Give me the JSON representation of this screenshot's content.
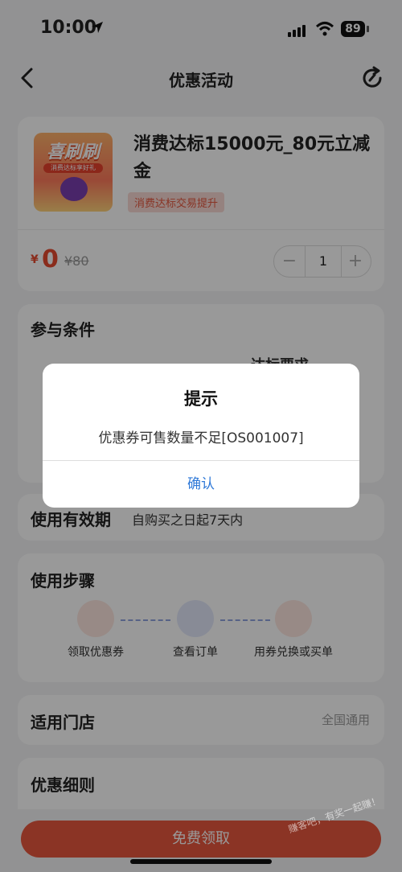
{
  "status_bar": {
    "time": "10:00",
    "battery": "89"
  },
  "nav": {
    "title": "优惠活动"
  },
  "product": {
    "thumb_title": "喜刷刷",
    "thumb_subtitle": "消费达标享好礼",
    "title": "消费达标15000元_80元立减金",
    "tag": "消费达标交易提升",
    "price_symbol": "¥",
    "price": "0",
    "original_price": "¥80",
    "quantity": "1"
  },
  "conditions": {
    "title": "参与条件",
    "col_header": "达标要求"
  },
  "validity": {
    "title": "使用有效期",
    "value": "自购买之日起7天内"
  },
  "steps": {
    "title": "使用步骤",
    "items": [
      {
        "label": "领取优惠券"
      },
      {
        "label": "查看订单"
      },
      {
        "label": "用券兑换或买单"
      }
    ]
  },
  "stores": {
    "title": "适用门店",
    "value": "全国通用"
  },
  "rules": {
    "title": "优惠细则"
  },
  "bottom": {
    "cta": "免费领取"
  },
  "dialog": {
    "title": "提示",
    "message": "优惠券可售数量不足[OS001007]",
    "confirm": "确认"
  },
  "watermark": "赚客吧，有奖一起赚！",
  "colors": {
    "accent": "#e8573f",
    "link": "#2f79d8",
    "overlay": "rgba(0,0,0,0.40)"
  }
}
